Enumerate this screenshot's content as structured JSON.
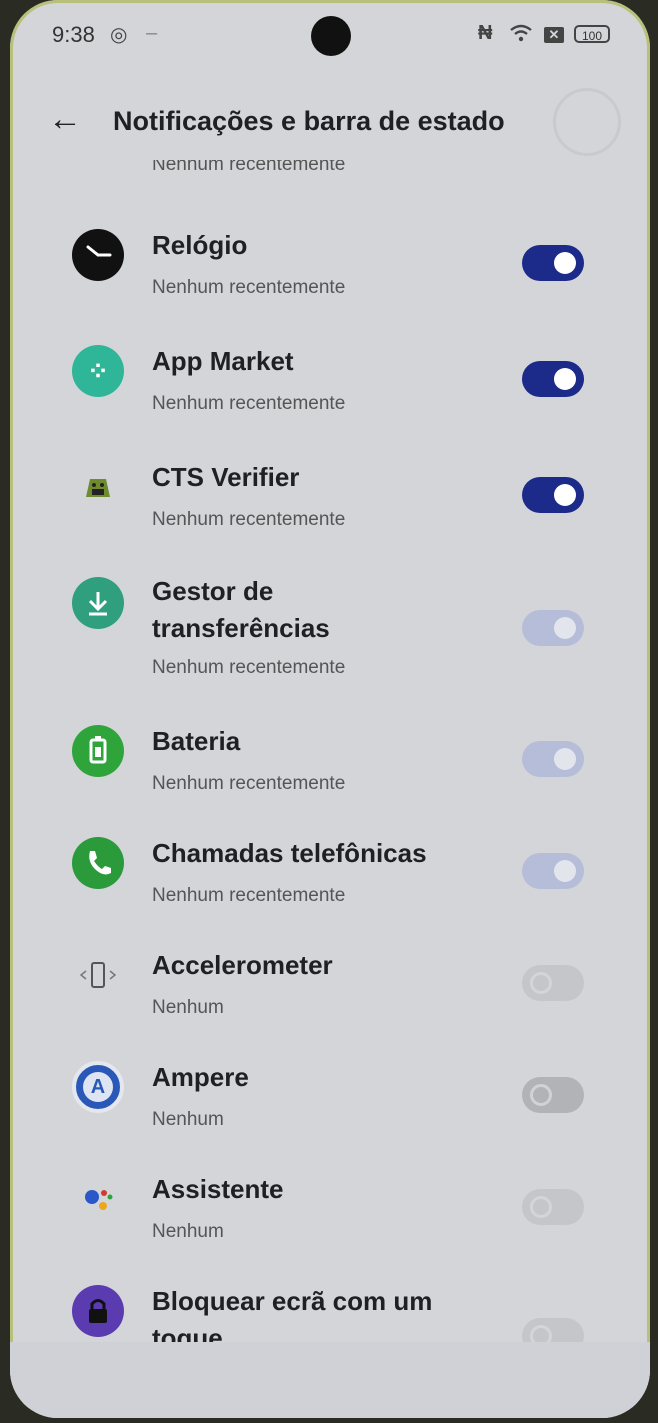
{
  "status_bar": {
    "time": "9:38",
    "battery": "100"
  },
  "header": {
    "title": "Notificações e barra de estado"
  },
  "cut_off_subtitle": "Nenhum recentemente",
  "apps": [
    {
      "name": "Relógio",
      "sub": "Nenhum recentemente",
      "toggle": "on",
      "icon": "clock-icon",
      "color": "#111111"
    },
    {
      "name": "App Market",
      "sub": "Nenhum recentemente",
      "toggle": "on",
      "icon": "app-market-icon",
      "color": "#2fb597"
    },
    {
      "name": "CTS Verifier",
      "sub": "Nenhum recentemente",
      "toggle": "on",
      "icon": "android-icon",
      "color": "#6f8a2f"
    },
    {
      "name": "Gestor de transferências",
      "sub": "Nenhum recentemente",
      "toggle": "on-disabled",
      "icon": "download-icon",
      "color": "#2f9f7e"
    },
    {
      "name": "Bateria",
      "sub": "Nenhum recentemente",
      "toggle": "on-disabled",
      "icon": "battery-icon",
      "color": "#2ea43b"
    },
    {
      "name": "Chamadas telefônicas",
      "sub": "Nenhum recentemente",
      "toggle": "on-disabled",
      "icon": "phone-icon",
      "color": "#2a9a3a"
    },
    {
      "name": "Accelerometer",
      "sub": "Nenhum",
      "toggle": "off-disabled",
      "icon": "accelerometer-icon",
      "color": "#d3d5d9"
    },
    {
      "name": "Ampere",
      "sub": "Nenhum",
      "toggle": "off",
      "icon": "ampere-icon",
      "color": "#2a58b8"
    },
    {
      "name": "Assistente",
      "sub": "Nenhum",
      "toggle": "off-disabled",
      "icon": "assistant-icon",
      "color": "#d3d5d9"
    },
    {
      "name": "Bloquear ecrã com um toque",
      "sub": "",
      "toggle": "off-disabled",
      "icon": "lock-icon",
      "color": "#5a3bb0"
    }
  ],
  "icon_glyphs": {
    "app_market": "⁘",
    "ampere": "A"
  }
}
